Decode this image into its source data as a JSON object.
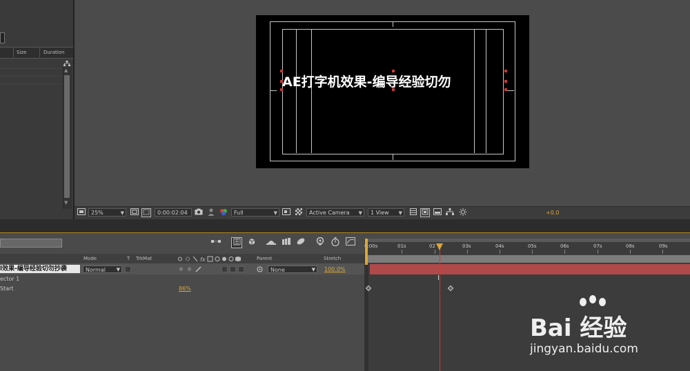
{
  "project_panel": {
    "columns": {
      "size": "Size",
      "duration": "Duration"
    }
  },
  "composition": {
    "title_text": "AE打字机效果-编导经验切勿"
  },
  "viewer_toolbar": {
    "zoom": "25%",
    "timecode": "0:00:02:04",
    "resolution": "Full",
    "camera": "Active Camera",
    "views": "1 View",
    "exposure": "+0.0"
  },
  "timeline": {
    "columns": {
      "mode": "Mode",
      "t": "T",
      "trkmat": "TrkMat",
      "parent": "Parent",
      "stretch": "Stretch"
    },
    "layer": {
      "name": "l效果-编导经验切勿抄袭",
      "mode": "Normal",
      "parent": "None",
      "stretch": "100.0%"
    },
    "animator": {
      "selector_label": "ector 1",
      "start_label": "Start",
      "start_value": "86%"
    },
    "ruler_labels": [
      "0:00s",
      "01s",
      "02",
      "03s",
      "04s",
      "05s",
      "06s",
      "07s",
      "08s",
      "09s"
    ]
  },
  "watermark": {
    "brand": "Bai 经验",
    "url": "jingyan.baidu.com"
  },
  "colors": {
    "accent": "#d9a83a",
    "playhead": "#e03030",
    "layer_bar": "#b04a4a"
  }
}
